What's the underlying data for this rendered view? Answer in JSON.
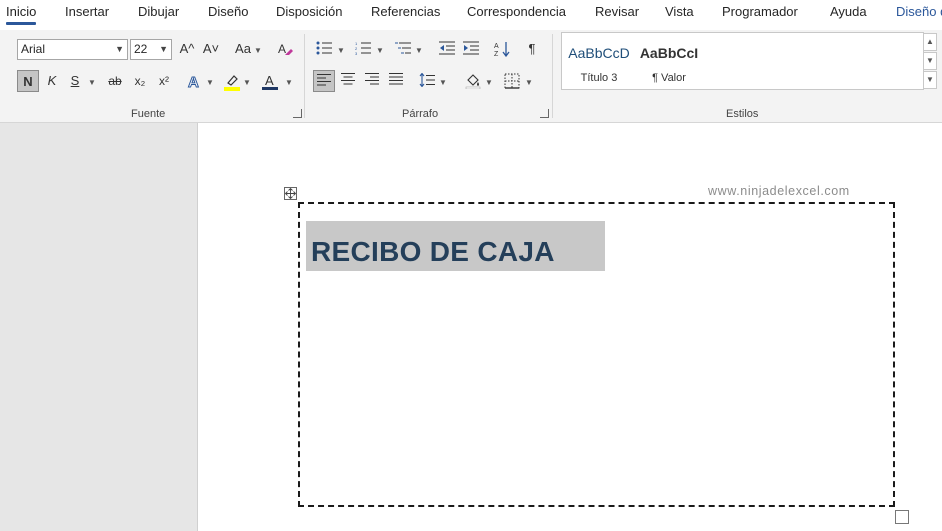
{
  "tabs": [
    "Inicio",
    "Insertar",
    "Dibujar",
    "Diseño",
    "Disposición",
    "Referencias",
    "Correspondencia",
    "Revisar",
    "Vista",
    "Programador",
    "Ayuda",
    "Diseño d"
  ],
  "ribbon": {
    "font_group_label": "Fuente",
    "paragraph_group_label": "Párrafo",
    "styles_group_label": "Estilos",
    "font_name": "Arial",
    "font_size": "22",
    "grow_font": "A^",
    "shrink_font": "A˅",
    "change_case": "Aa",
    "bold": "N",
    "italic": "K",
    "underline": "S",
    "strike": "ab",
    "subscript": "x₂",
    "superscript": "x²",
    "pilcrow": "¶"
  },
  "styles": [
    {
      "preview": "AaBbCcD",
      "name": "Título 3"
    },
    {
      "preview": "AaBbCcI",
      "name": "¶ Valor"
    }
  ],
  "colors": {
    "accent": "#2b579a",
    "highlight": "#ffff00",
    "font_color": "#1f3864",
    "title_text": "#243f5a",
    "title_bg": "#c8c8c8"
  },
  "document": {
    "watermark": "www.ninjadelexcel.com",
    "title": "RECIBO DE CAJA"
  }
}
